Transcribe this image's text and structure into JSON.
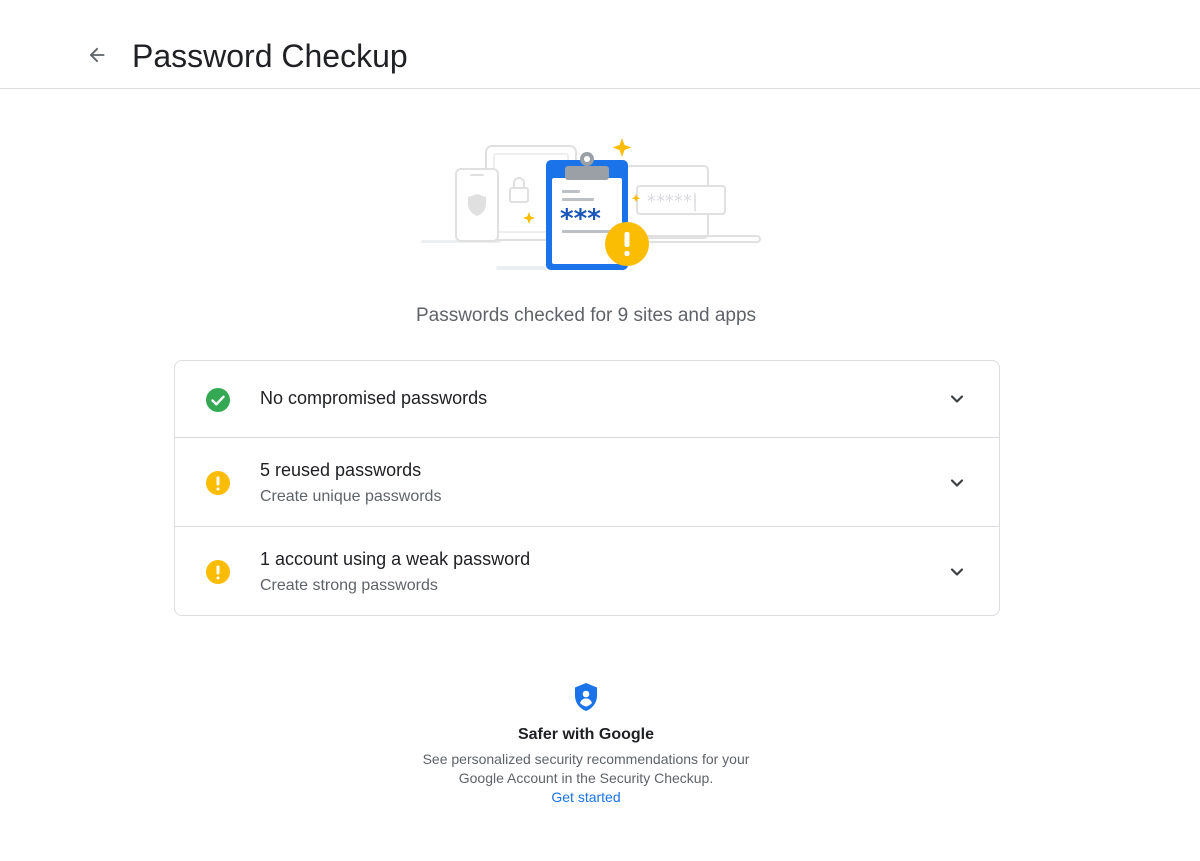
{
  "header": {
    "title": "Password Checkup",
    "back_icon": "arrow-back-icon"
  },
  "illustration": {
    "masked_password": "***",
    "masked_field": "*****|"
  },
  "summary": "Passwords checked for 9 sites and apps",
  "results": [
    {
      "icon": "check-circle-icon",
      "status_color": "#34a853",
      "title": "No compromised passwords",
      "subtitle": ""
    },
    {
      "icon": "warning-circle-icon",
      "status_color": "#fbbc04",
      "title": "5 reused passwords",
      "subtitle": "Create unique passwords"
    },
    {
      "icon": "warning-circle-icon",
      "status_color": "#fbbc04",
      "title": "1 account using a weak password",
      "subtitle": "Create strong passwords"
    }
  ],
  "promo": {
    "icon": "shield-person-icon",
    "title": "Safer with Google",
    "description": "See personalized security recommendations for your Google Account in the Security Checkup.",
    "link": "Get started"
  },
  "colors": {
    "accent": "#1a73e8",
    "success": "#34a853",
    "warning": "#fbbc04"
  }
}
